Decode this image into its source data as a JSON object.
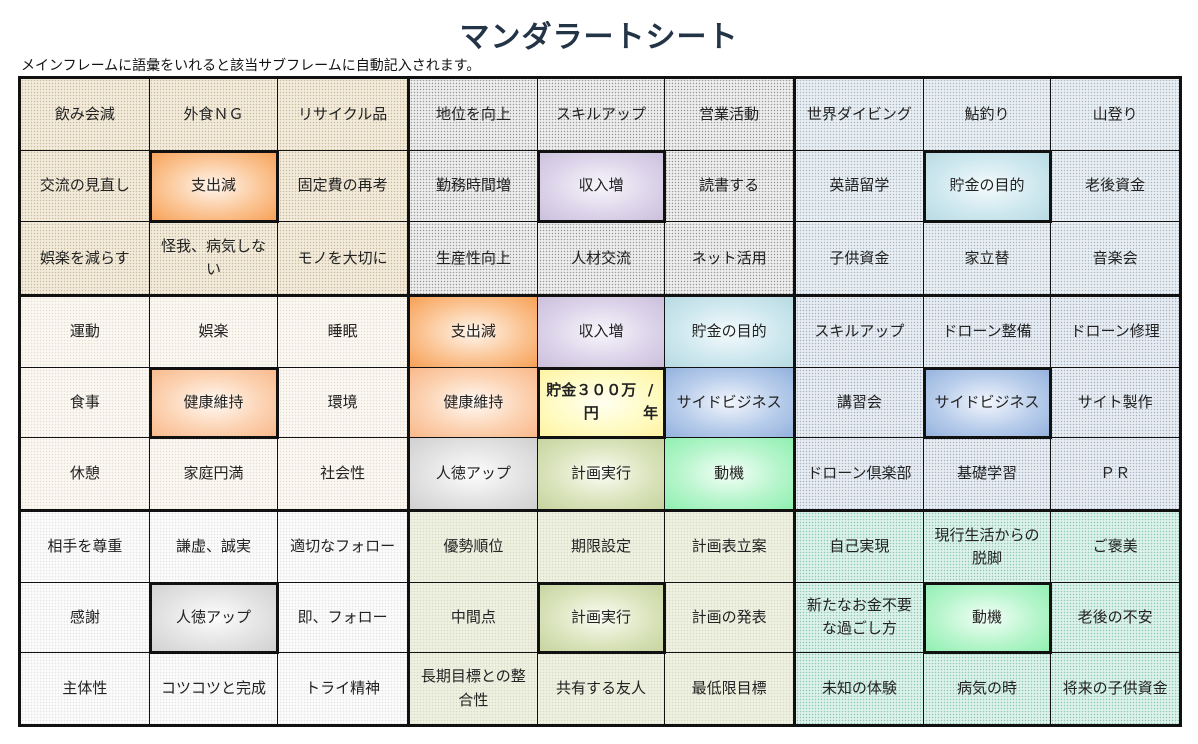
{
  "header": {
    "title": "マンダラートシート",
    "subtitle": "メインフレームに語彙をいれると該当サブフレームに自動記入されます。"
  },
  "theme_colors": {
    "expense": "#f7a055",
    "income": "#cbbfdc",
    "savings_purpose": "#b7dae3",
    "side_business": "#93b1dd",
    "goal": "#fff3a0",
    "virtue": "#d0d0d0",
    "plan": "#c6d39e",
    "motivation": "#8ef0b0",
    "border": "#111111",
    "title": "#243447"
  },
  "blocks": [
    {
      "name": "expense-reduction",
      "cells": [
        "飲み会減",
        "外食ＮＧ",
        "リサイクル品",
        "交流の見直し",
        "支出減",
        "固定費の再考",
        "娯楽を減らす",
        "怪我、病気しない",
        "モノを大切に"
      ]
    },
    {
      "name": "income-increase",
      "cells": [
        "地位を向上",
        "スキルアップ",
        "営業活動",
        "勤務時間増",
        "収入増",
        "読書する",
        "生産性向上",
        "人材交流",
        "ネット活用"
      ]
    },
    {
      "name": "savings-purpose",
      "cells": [
        "世界ダイビング",
        "鮎釣り",
        "山登り",
        "英語留学",
        "貯金の目的",
        "老後資金",
        "子供資金",
        "家立替",
        "音楽会"
      ]
    },
    {
      "name": "health-maintenance",
      "cells": [
        "運動",
        "娯楽",
        "睡眠",
        "食事",
        "健康維持",
        "環境",
        "休憩",
        "家庭円満",
        "社会性"
      ]
    },
    {
      "name": "main-frame",
      "cells": [
        "支出減",
        "収入増",
        "貯金の目的",
        "健康維持",
        "貯金３００万円/年",
        "サイドビジネス",
        "人徳アップ",
        "計画実行",
        "動機"
      ]
    },
    {
      "name": "side-business",
      "cells": [
        "スキルアップ",
        "ドローン整備",
        "ドローン修理",
        "講習会",
        "サイドビジネス",
        "サイト製作",
        "ドローン倶楽部",
        "基礎学習",
        "ＰＲ"
      ]
    },
    {
      "name": "virtue-up",
      "cells": [
        "相手を尊重",
        "謙虚、誠実",
        "適切なフォロー",
        "感謝",
        "人徳アップ",
        "即、フォロー",
        "主体性",
        "コツコツと完成",
        "トライ精神"
      ]
    },
    {
      "name": "plan-execution",
      "cells": [
        "優勢順位",
        "期限設定",
        "計画表立案",
        "中間点",
        "計画実行",
        "計画の発表",
        "長期目標との整合性",
        "共有する友人",
        "最低限目標"
      ]
    },
    {
      "name": "motivation",
      "cells": [
        "自己実現",
        "現行生活からの脱脚",
        "ご褒美",
        "新たなお金不要な過ごし方",
        "動機",
        "老後の不安",
        "未知の体験",
        "病気の時",
        "将来の子供資金"
      ]
    }
  ]
}
